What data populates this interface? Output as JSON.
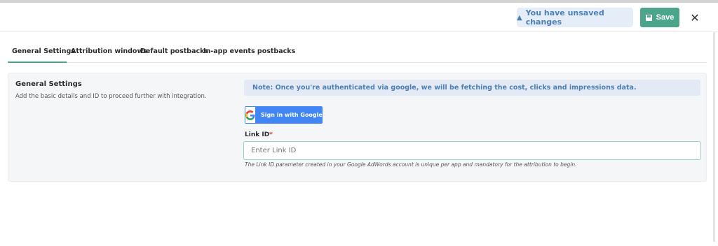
{
  "header": {
    "unsaved_label": "You have unsaved changes",
    "save_label": "Save",
    "close_glyph": "✕"
  },
  "tabs": [
    {
      "label": "General Settings",
      "active": true
    },
    {
      "label": "Attribution windows",
      "active": false
    },
    {
      "label": "Default postbacks",
      "active": false
    },
    {
      "label": "In-app events postbacks",
      "active": false
    }
  ],
  "section": {
    "title": "General Settings",
    "description": "Add the basic details and ID to proceed further with integration.",
    "note": "Note: Once you're authenticated via google, we will be fetching the cost, clicks and impressions data.",
    "google_button_label": "Sign in with Google",
    "link_id_label": "Link ID",
    "required_mark": "*",
    "link_id_placeholder": "Enter Link ID",
    "link_id_value": "",
    "hint": "The Link ID parameter created in your Google AdWords account is unique per app and mandatory for the attribution to begin."
  },
  "colors": {
    "accent": "#4aa58a",
    "info": "#4b7fb6",
    "google_blue": "#4285f4"
  },
  "icons": {
    "warning": "warning-icon",
    "save": "floppy-icon",
    "close": "close-icon",
    "google": "google-icon"
  }
}
